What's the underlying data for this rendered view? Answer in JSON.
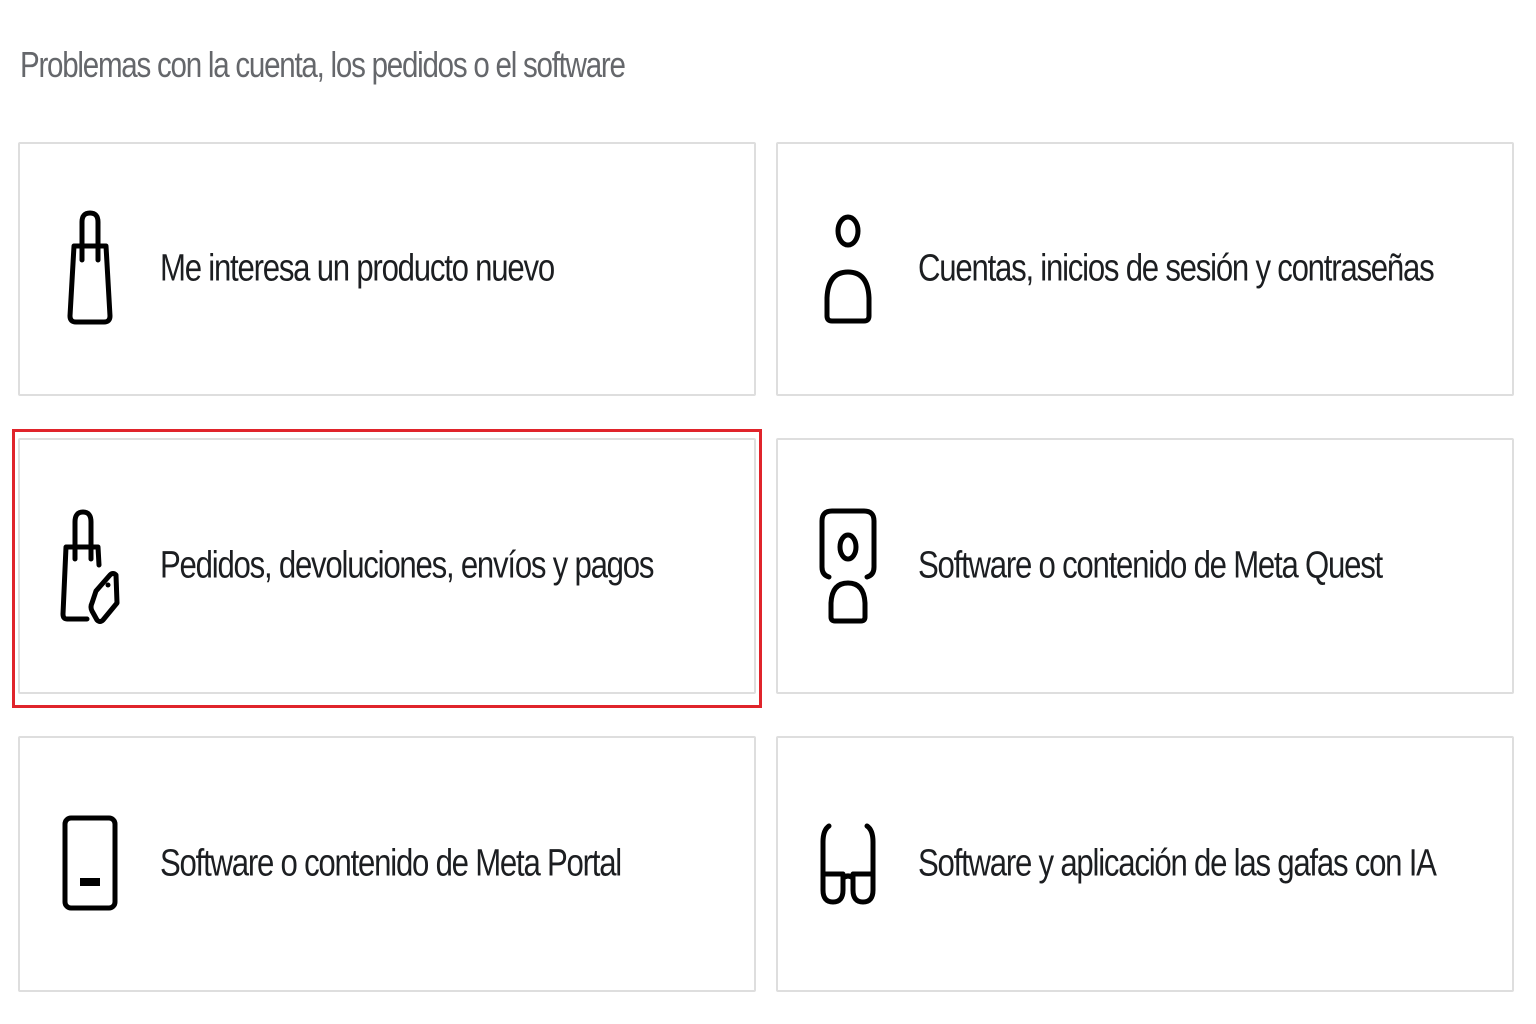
{
  "section": {
    "title": "Problemas con la cuenta, los pedidos o el software"
  },
  "highlight_color": "#e0242b",
  "cards": [
    {
      "label": "Me interesa un producto nuevo",
      "icon": "shopping-bag-icon"
    },
    {
      "label": "Cuentas, inicios de sesión y contraseñas",
      "icon": "person-icon"
    },
    {
      "label": "Pedidos, devoluciones, envíos y pagos",
      "icon": "bag-tag-icon",
      "highlighted": true
    },
    {
      "label": "Software o contenido de Meta Quest",
      "icon": "vr-headset-icon"
    },
    {
      "label": "Software o contenido de Meta Portal",
      "icon": "tablet-icon"
    },
    {
      "label": "Software y aplicación de las gafas con IA",
      "icon": "glasses-icon"
    }
  ]
}
